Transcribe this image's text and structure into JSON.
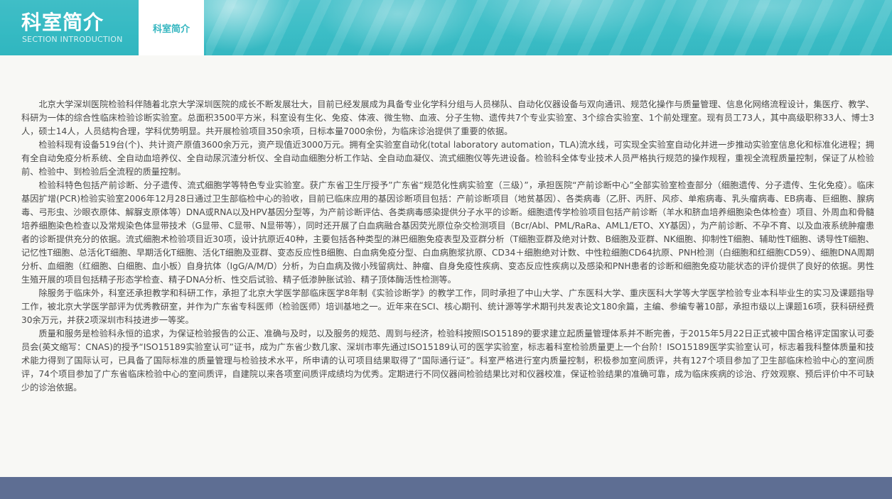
{
  "header": {
    "title": "科室简介",
    "subtitle": "SECTION INTRODUCTION",
    "tab_label": "科室简介",
    "accent_color": "#3bbdc6"
  },
  "content": {
    "paragraphs": [
      "北京大学深圳医院检验科伴随着北京大学深圳医院的成长不断发展壮大，目前已经发展成为具备专业化学科分组与人员梯队、自动化仪器设备与双向通讯、规范化操作与质量管理、信息化网络流程设计，集医疗、教学、科研为一体的综合性临床检验诊断实验室。总面积3500平方米，科室设有生化、免疫、体液、微生物、血液、分子生物、遗传共7个专业实验室、3个综合实验室、1个前处理室。现有员工73人，其中高级职称33人、博士3人，硕士14人，人员结构合理，学科优势明显。共开展检验项目350余项，日标本量7000余份，为临床诊治提供了重要的依据。",
      "检验科现有设备519台(个)、共计资产原值3600余万元，资产现值近3000万元。拥有全实验室自动化(total laboratory automation，TLA)流水线，可实现全实验室自动化并进一步推动实验室信息化和标准化进程；拥有全自动免疫分析系统、全自动血培养仪、全自动尿沉渣分析仪、全自动血细胞分析工作站、全自动血凝仪、流式细胞仪等先进设备。检验科全体专业技术人员严格执行规范的操作规程，重视全流程质量控制，保证了从检验前、检验中、到检验后全流程的质量控制。",
      "检验科特色包括产前诊断、分子遗传、流式细胞学等特色专业实验室。获广东省卫生厅授予”广东省“规范化性病实验室（三级）”，承担医院“产前诊断中心”全部实验室检查部分（细胞遗传、分子遗传、生化免疫）。临床基因扩增(PCR)检验实验室2006年12月28日通过卫生部临检中心的验收，目前已临床应用的基因诊断项目包括：产前诊断项目（地贫基因）、各类病毒（乙肝、丙肝、风疹、单疱病毒、乳头瘤病毒、EB病毒、巨细胞、腺病毒、弓形虫、沙眼衣原体、解脲支原体等）DNA或RNA以及HPV基因分型等，为产前诊断评估、各类病毒感染提供分子水平的诊断。细胞遗传学检验项目包括产前诊断（羊水和脐血培养细胞染色体检查）项目、外周血和骨髓培养细胞染色检查以及常规染色体显带技术（G显带、C显带、N显带等），同时还开展了白血病融合基因荧光原位杂交检测项目（Bcr/Abl、PML/RaRa、AML1/ETO、XY基因），为产前诊断、不孕不育、以及血液系统肿瘤患者的诊断提供充分的依据。流式细胞术检验项目近30项，设计抗原近40种，主要包括各种类型的淋巴细胞免疫表型及亚群分析（T细胞亚群及绝对计数、B细胞及亚群、NK细胞、抑制性T细胞、辅助性T细胞、诱导性T细胞、记忆性T细胞、总活化T细胞、早期活化T细胞、活化T细胞及亚群、变态反应性B细胞、白血病免疫分型、白血病胞浆抗原、CD34＋细胞绝对计数、中性粒细胞CD64抗原、PNH检测（白细胞和红细胞CD59）、细胞DNA周期分析、血细胞（红细胞、白细胞、血小板）自身抗体（IgG/A/M/D）分析，为白血病及微小残留病灶、肿瘤、自身免疫性疾病、变态反应性疾病以及感染和PNH患者的诊断和细胞免疫功能状态的评价提供了良好的依据。男性生殖开展的项目包括精子形态学检查、精子DNA分析、性交后试验、精子低渗肿胀试验、精子顶体酶活性检测等。",
      "除服务于临床外，科室还承担教学和科研工作，承担了北京大学医学部临床医学8年制《实验诊断学》的教学工作，同时承担了中山大学、广东医科大学、重庆医科大学等大学医学检验专业本科毕业生的实习及课题指导工作，被北京大学医学部评为优秀教研室，并作为广东省专科医师（检验医师）培训基地之一。近年来在SCI、核心期刊、统计源等学术期刊共发表论文180余篇，主编、参编专著10部，承担市级以上课题16项，获科研经费30余万元，并获2项深圳市科技进步一等奖。",
      "质量和服务是检验科永恒的追求，为保证检验报告的公正、准确与及时，以及服务的规范、周到与经济，检验科按照ISO15189的要求建立起质量管理体系并不断完善，于2015年5月22日正式被中国合格评定国家认可委员会(英文缩写：CNAS)的授予“ISO15189实验室认可”证书，成为广东省少数几家、深圳市率先通过ISO15189认可的医学实验室，标志着科室检验质量更上一个台阶！ISO15189医学实验室认可，标志着我科整体质量和技术能力得到了国际认可，已具备了国际标准的质量管理与检验技术水平，所申请的认可项目结果取得了“国际通行证”。科室严格进行室内质量控制，积极参加室间质评，共有127个项目参加了卫生部临床检验中心的室间质评，74个项目参加了广东省临床检验中心的室间质评，自建院以来各项室间质评成绩均为优秀。定期进行不同仪器间检验结果比对和仪器校准，保证检验结果的准确可靠，成为临床疾病的诊治、疗效观察、预后评价中不可缺少的诊治依据。"
    ]
  },
  "footer": {
    "color": "#5e6e93"
  }
}
